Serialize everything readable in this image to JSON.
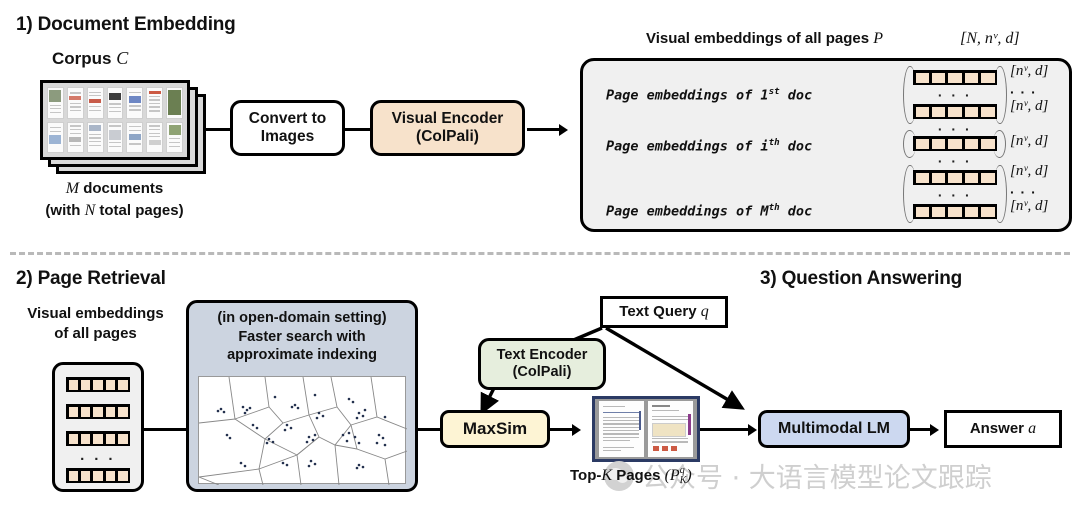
{
  "sections": {
    "s1_title": "1) Document Embedding",
    "s2_title": "2) Page Retrieval",
    "s3_title": "3) Question Answering"
  },
  "section1": {
    "corpus_label_text": "Corpus ",
    "corpus_label_sym": "C",
    "corpus_caption_line1_a": "M",
    "corpus_caption_line1_b": " documents",
    "corpus_caption_line2_a": "(with ",
    "corpus_caption_line2_b": "N",
    "corpus_caption_line2_c": " total pages)",
    "convert_box": "Convert to\nImages",
    "convert_box_line1": "Convert to",
    "convert_box_line2": "Images",
    "visual_encoder_line1": "Visual Encoder",
    "visual_encoder_line2": "(ColPali)",
    "panel_title_text": "Visual embeddings of all pages ",
    "panel_title_sym": "P",
    "panel_shape": "[N, nᵛ, d]",
    "rows": [
      {
        "label": "Page embeddings of 1st doc",
        "label_main": "Page embeddings of 1",
        "label_sup": "st",
        "label_tail": " doc",
        "shapes": [
          "[nᵛ, d]",
          "· · ·",
          "[nᵛ, d]"
        ],
        "vectors": 2
      },
      {
        "label": "Page embeddings of ith doc",
        "label_main": "Page embeddings of i",
        "label_sup": "th",
        "label_tail": " doc",
        "shapes": [
          "[nᵛ, d]"
        ],
        "vectors": 1
      },
      {
        "label": "Page embeddings of Mth doc",
        "label_main": "Page embeddings of M",
        "label_sup": "th",
        "label_tail": " doc",
        "shapes": [
          "[nᵛ, d]",
          "· · ·",
          "[nᵛ, d]"
        ],
        "vectors": 2
      }
    ],
    "ellipsis": "· · ·"
  },
  "section2": {
    "left_label_line1": "Visual embeddings",
    "left_label_line2": "of all pages",
    "index_line1": "(in open-domain setting)",
    "index_line2": "Faster search with",
    "index_line3": "approximate indexing",
    "ellipsis": "· · ·",
    "stack_vectors": 4
  },
  "section3": {
    "text_query_text": "Text Query ",
    "text_query_sym": "q",
    "text_encoder_line1": "Text Encoder",
    "text_encoder_line2": "(ColPali)",
    "maxsim": "MaxSim",
    "multimodal_lm": "Multimodal LM",
    "answer_text": "Answer ",
    "answer_sym": "a",
    "topk_caption_a": "Top-",
    "topk_caption_k": "K",
    "topk_caption_b": " Pages ",
    "topk_caption_paren_open": "(",
    "topk_caption_p": "P",
    "topk_caption_sup": "q",
    "topk_caption_sub": "K",
    "topk_caption_paren_close": ")"
  },
  "watermark": {
    "text": "公众号 · 大语言模型论文跟踪"
  },
  "colors": {
    "visual_encoder_fill": "#f7e2cb",
    "text_encoder_fill": "#e6eedd",
    "maxsim_fill": "#fdf4d4",
    "multimodal_fill": "#ccd8f0",
    "index_fill": "#ccd4e0",
    "panel_fill": "#f0f0f0",
    "vector_cell": "#f7e2cb",
    "stroke": "#000000",
    "divider": "#b9b9b9",
    "topk_frame": "#2b3a64",
    "watermark": "#cfcfcf"
  }
}
